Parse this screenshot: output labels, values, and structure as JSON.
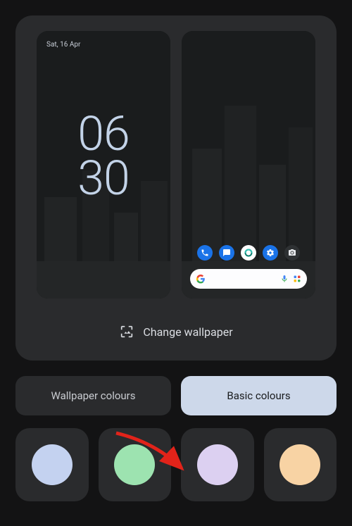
{
  "lockscreen": {
    "date": "Sat, 16 Apr",
    "clock_hours": "06",
    "clock_minutes": "30"
  },
  "dock": {
    "icons": [
      {
        "name": "phone-icon",
        "bg": "#1a73e8"
      },
      {
        "name": "messages-icon",
        "bg": "#1a73e8"
      },
      {
        "name": "edge-icon",
        "bg": "#ffffff"
      },
      {
        "name": "settings-icon",
        "bg": "#1a73e8"
      },
      {
        "name": "camera-icon",
        "bg": "#2e3133"
      }
    ]
  },
  "change_wallpaper": {
    "label": "Change wallpaper"
  },
  "tabs": {
    "wallpaper": "Wallpaper colours",
    "basic": "Basic colours",
    "active": "basic"
  },
  "swatches": [
    {
      "color": "#c4d2f0"
    },
    {
      "color": "#9de3b0"
    },
    {
      "color": "#dcd0f1"
    },
    {
      "color": "#f8d3a4"
    }
  ]
}
